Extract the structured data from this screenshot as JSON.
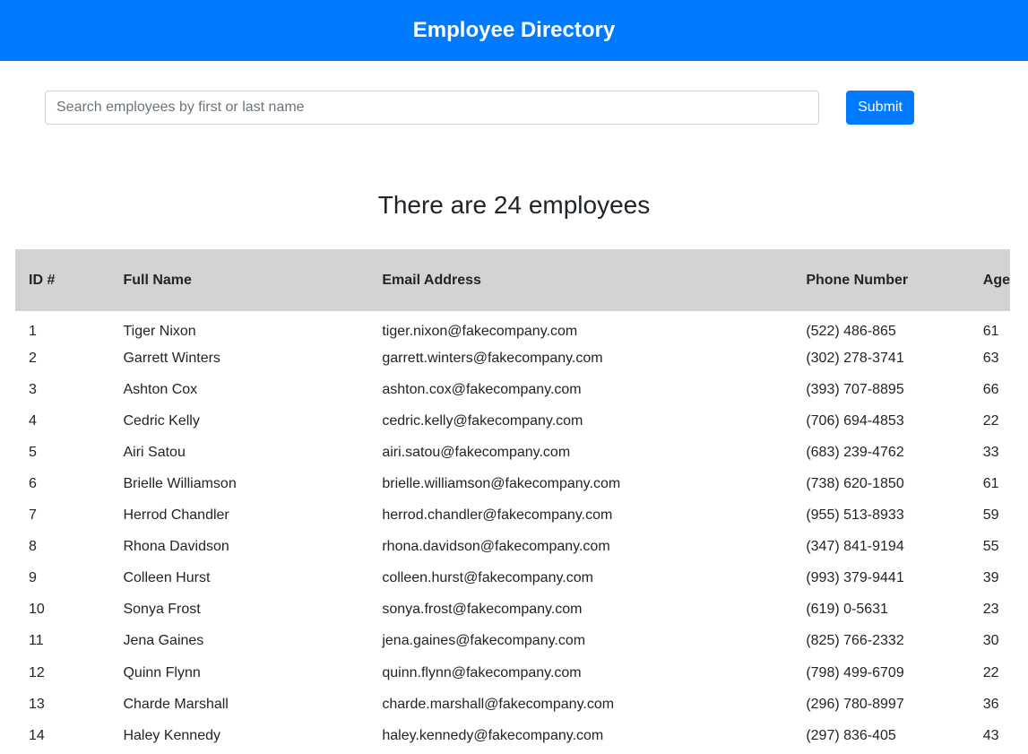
{
  "header": {
    "title": "Employee Directory"
  },
  "search": {
    "placeholder": "Search employees by first or last name",
    "value": "",
    "submit_label": "Submit"
  },
  "summary": {
    "text": "There are 24 employees"
  },
  "table": {
    "headers": {
      "id": "ID #",
      "name": "Full Name",
      "email": "Email Address",
      "phone": "Phone Number",
      "age": "Age"
    },
    "rows": [
      {
        "id": "1",
        "name": "Tiger Nixon",
        "email": "tiger.nixon@fakecompany.com",
        "phone": "(522) 486-865",
        "age": "61"
      },
      {
        "id": "2",
        "name": "Garrett Winters",
        "email": "garrett.winters@fakecompany.com",
        "phone": "(302) 278-3741",
        "age": "63"
      },
      {
        "id": "3",
        "name": "Ashton Cox",
        "email": "ashton.cox@fakecompany.com",
        "phone": "(393) 707-8895",
        "age": "66"
      },
      {
        "id": "4",
        "name": "Cedric Kelly",
        "email": "cedric.kelly@fakecompany.com",
        "phone": "(706) 694-4853",
        "age": "22"
      },
      {
        "id": "5",
        "name": "Airi Satou",
        "email": "airi.satou@fakecompany.com",
        "phone": "(683) 239-4762",
        "age": "33"
      },
      {
        "id": "6",
        "name": "Brielle Williamson",
        "email": "brielle.williamson@fakecompany.com",
        "phone": "(738) 620-1850",
        "age": "61"
      },
      {
        "id": "7",
        "name": "Herrod Chandler",
        "email": "herrod.chandler@fakecompany.com",
        "phone": "(955) 513-8933",
        "age": "59"
      },
      {
        "id": "8",
        "name": "Rhona Davidson",
        "email": "rhona.davidson@fakecompany.com",
        "phone": "(347) 841-9194",
        "age": "55"
      },
      {
        "id": "9",
        "name": "Colleen Hurst",
        "email": "colleen.hurst@fakecompany.com",
        "phone": "(993) 379-9441",
        "age": "39"
      },
      {
        "id": "10",
        "name": "Sonya Frost",
        "email": "sonya.frost@fakecompany.com",
        "phone": "(619) 0-5631",
        "age": "23"
      },
      {
        "id": "11",
        "name": "Jena Gaines",
        "email": "jena.gaines@fakecompany.com",
        "phone": "(825) 766-2332",
        "age": "30"
      },
      {
        "id": "12",
        "name": "Quinn Flynn",
        "email": "quinn.flynn@fakecompany.com",
        "phone": "(798) 499-6709",
        "age": "22"
      },
      {
        "id": "13",
        "name": "Charde Marshall",
        "email": "charde.marshall@fakecompany.com",
        "phone": "(296) 780-8997",
        "age": "36"
      },
      {
        "id": "14",
        "name": "Haley Kennedy",
        "email": "haley.kennedy@fakecompany.com",
        "phone": "(297) 836-405",
        "age": "43"
      }
    ]
  },
  "colors": {
    "header_bg": "#007bff",
    "button_bg": "#007bff",
    "table_header_bg": "#d3d3d3"
  }
}
